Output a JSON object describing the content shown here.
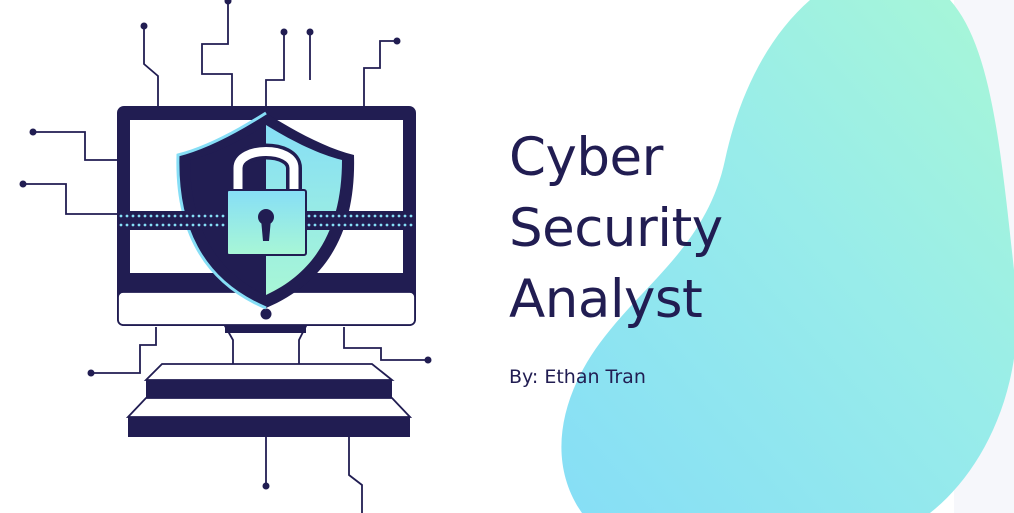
{
  "slide": {
    "title_lines": [
      "Cyber",
      "Security",
      "Analyst"
    ],
    "byline": "By: Ethan Tran"
  },
  "illustration": {
    "subject": "computer-monitor-with-shield-and-padlock",
    "icons": [
      "monitor-icon",
      "shield-icon",
      "padlock-icon",
      "keyhole-icon",
      "circuit-lines"
    ]
  },
  "colors": {
    "navy": "#211d52",
    "mint": "#a8f7d6",
    "sky": "#86def6",
    "background": "#ffffff"
  }
}
